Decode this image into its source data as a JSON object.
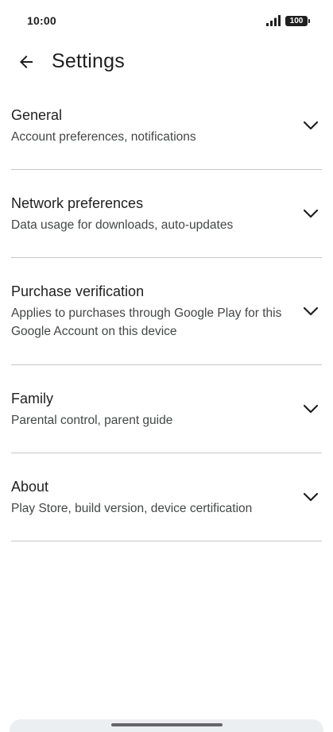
{
  "status_bar": {
    "time": "10:00",
    "battery": "100",
    "signal_icon": "signal-bars-icon"
  },
  "app_bar": {
    "back_icon": "arrow-back-icon",
    "title": "Settings"
  },
  "settings": {
    "items": [
      {
        "title": "General",
        "subtitle": "Account preferences, notifications",
        "icon": "chevron-down-icon"
      },
      {
        "title": "Network preferences",
        "subtitle": "Data usage for downloads, auto-updates",
        "icon": "chevron-down-icon"
      },
      {
        "title": "Purchase verification",
        "subtitle": "Applies to purchases through Google Play for this Google Account on this device",
        "icon": "chevron-down-icon"
      },
      {
        "title": "Family",
        "subtitle": "Parental control, parent guide",
        "icon": "chevron-down-icon"
      },
      {
        "title": "About",
        "subtitle": "Play Store, build version, device certification",
        "icon": "chevron-down-icon"
      }
    ]
  }
}
